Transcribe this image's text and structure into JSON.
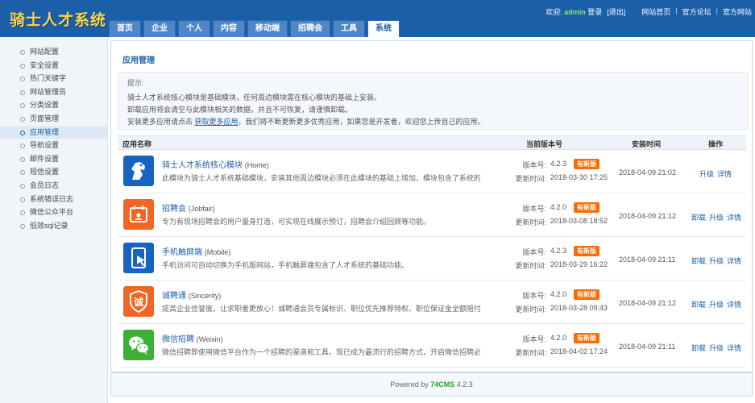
{
  "logo": "骑士人才系统",
  "nav": {
    "tabs": [
      "首页",
      "企业",
      "个人",
      "内容",
      "移动端",
      "招聘会",
      "工具",
      "系统"
    ],
    "active": "系统"
  },
  "toplinks": {
    "welcome": "欢迎:",
    "user": "admin",
    "login_suffix": "登录",
    "logout": "[退出]",
    "home": "网站首页",
    "sep1": "|",
    "forum": "官方论坛",
    "sep2": "|",
    "official": "官方网站"
  },
  "sidebar": {
    "items": [
      {
        "label": "网站配置"
      },
      {
        "label": "安全设置"
      },
      {
        "label": "热门关键字"
      },
      {
        "label": "网站管理员"
      },
      {
        "label": "分类设置"
      },
      {
        "label": "页面管理"
      },
      {
        "label": "应用管理"
      },
      {
        "label": "导航设置"
      },
      {
        "label": "邮件设置"
      },
      {
        "label": "短信设置"
      },
      {
        "label": "会员日志"
      },
      {
        "label": "系统错误日志"
      },
      {
        "label": "微信公众平台"
      },
      {
        "label": "低效sql记录"
      }
    ],
    "active": "应用管理"
  },
  "panel": {
    "title": "应用管理",
    "tip_head": "提示:",
    "tip1": "骑士人才系统核心模块是基础模块，任何周边模块需在核心模块的基础上安装。",
    "tip2": "卸载应用将会清空与此模块相关的数据，并且不可恢复，请谨慎卸载。",
    "tip3_pre": "安装更多应用请点击",
    "tip3_link": "获取更多应用",
    "tip3_post": "，我们将不断更新更多优秀应用，如果您是开发者，欢迎您上传自己的应用。"
  },
  "table": {
    "headers": {
      "name": "应用名称",
      "version": "当前版本号",
      "install": "安装时间",
      "action": "操作"
    },
    "ver_label": "版本号:",
    "upd_label": "更新时间:",
    "badge": "有新版",
    "rows": [
      {
        "name": "骑士人才系统核心模块",
        "en": "(Home)",
        "desc": "此模块为骑士人才系统基础模块，安装其他周边模块必须在此模块的基础上增加，模块包含了系统的招聘求职等",
        "version": "4.2.3",
        "updated": "2018-03-30 17:25",
        "installed": "2018-04-09 21:02",
        "actions": [
          "升级",
          "详情"
        ],
        "icon_color": "#1565c0"
      },
      {
        "name": "招聘会",
        "en": "(Jobfair)",
        "desc": "专为有现场招聘会的用户量身打造，可实现在线展示预订，招聘会介绍回顾等功能。",
        "version": "4.2.0",
        "updated": "2018-03-08 18:52",
        "installed": "2018-04-09 21:12",
        "actions": [
          "卸载",
          "升级",
          "详情"
        ],
        "icon_color": "#f26522"
      },
      {
        "name": "手机触屏端",
        "en": "(Mobile)",
        "desc": "手机访问可自动切换为手机版网站，手机触屏端包含了人才系统的基础功能。",
        "version": "4.2.3",
        "updated": "2018-03-29 16:22",
        "installed": "2018-04-09 21:11",
        "actions": [
          "卸载",
          "升级",
          "详情"
        ],
        "icon_color": "#1565c0"
      },
      {
        "name": "诚聘通",
        "en": "(Sincerity)",
        "desc": "提高企业信誉度，让求职者更放心！诚聘通会员专属标识、职位优先推荐特权、职位保证金全额赔付退还。",
        "version": "4.2.0",
        "updated": "2018-03-28 09:43",
        "installed": "2018-04-09 21:12",
        "actions": [
          "卸载",
          "升级",
          "详情"
        ],
        "icon_color": "#f26522"
      },
      {
        "name": "微信招聘",
        "en": "(Weixin)",
        "desc": "微信招聘即使用微信平台作为一个招聘的渠道和工具，现已成为最流行的招聘方式，开启微信招聘必须先安装手机",
        "version": "4.2.0",
        "updated": "2018-04-02 17:24",
        "installed": "2018-04-09 21:11",
        "actions": [
          "卸载",
          "升级",
          "详情"
        ],
        "icon_color": "#3cb034"
      }
    ]
  },
  "footer": {
    "pre": "Powered by ",
    "brand": "74CMS",
    "post": " 4.2.3"
  }
}
